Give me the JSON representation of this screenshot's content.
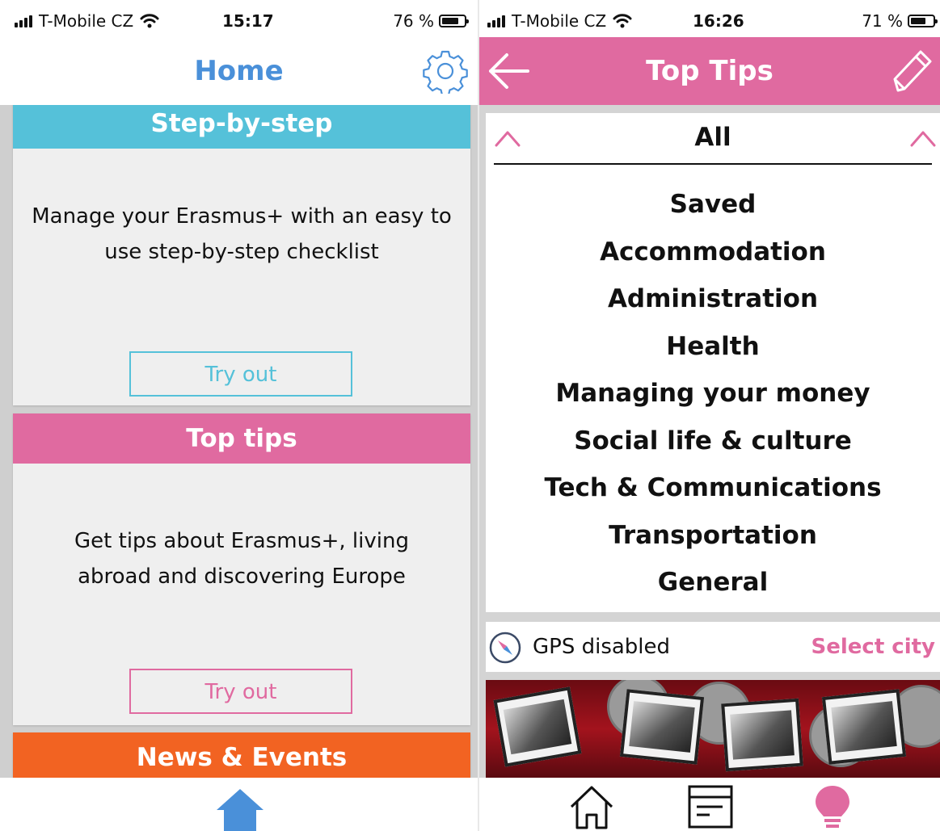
{
  "left_screen": {
    "status": {
      "carrier": "T-Mobile CZ",
      "time": "15:17",
      "battery": "76 %",
      "battery_level": 0.76
    },
    "header": {
      "title": "Home",
      "settings_icon": "gear-icon"
    },
    "cards": [
      {
        "title": "Step-by-step",
        "description": "Manage your Erasmus+ with an easy to use step-by-step checklist",
        "button": "Try out",
        "color": "#55c1d9"
      },
      {
        "title": "Top tips",
        "description": "Get tips about Erasmus+, living abroad and discovering Europe",
        "button": "Try out",
        "color": "#e06aa0"
      },
      {
        "title": "News & Events",
        "color": "#f26322"
      }
    ],
    "tab_bar": {
      "icons": [
        "home-icon"
      ],
      "active_color": "#4a90d9"
    }
  },
  "right_screen": {
    "status": {
      "carrier": "T-Mobile CZ",
      "time": "16:26",
      "battery": "71 %",
      "battery_level": 0.71
    },
    "header": {
      "title": "Top Tips",
      "back_icon": "arrow-left-icon",
      "edit_icon": "pencil-icon"
    },
    "category_picker": {
      "selected": "All",
      "options": [
        "Saved",
        "Accommodation",
        "Administration",
        "Health",
        "Managing your money",
        "Social life & culture",
        "Tech & Communications",
        "Transportation",
        "General"
      ]
    },
    "location": {
      "status": "GPS disabled",
      "action": "Select city"
    },
    "tab_bar": {
      "icons": [
        "home-icon",
        "news-icon",
        "lightbulb-icon"
      ],
      "active_color": "#e06aa0"
    }
  },
  "colors": {
    "blue": "#4a90d9",
    "pink": "#e06aa0",
    "cyan": "#55c1d9",
    "orange": "#f26322"
  }
}
